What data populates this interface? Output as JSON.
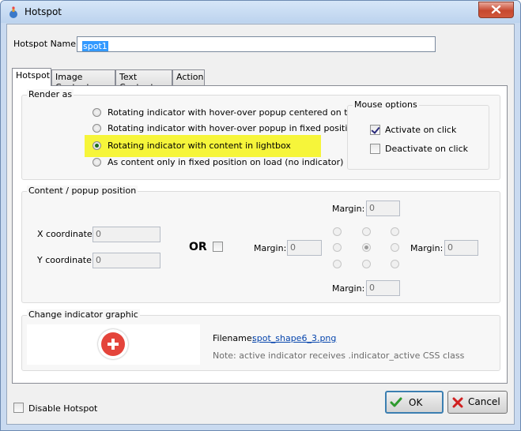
{
  "window": {
    "title": "Hotspot"
  },
  "hotspot_name": {
    "label": "Hotspot Name:",
    "value": "spot1"
  },
  "tabs": [
    {
      "label": "Hotspot"
    },
    {
      "label": "Image Content"
    },
    {
      "label": "Text Content"
    },
    {
      "label": "Action"
    }
  ],
  "render_as": {
    "title": "Render as",
    "options": [
      "Rotating indicator with hover-over popup centered on top",
      "Rotating indicator with hover-over popup in fixed position",
      "Rotating indicator with content in lightbox",
      "As content only in fixed position on load (no indicator)"
    ],
    "selected_index": 2
  },
  "mouse_options": {
    "title": "Mouse  options",
    "activate_label": "Activate on click",
    "activate_checked": true,
    "deactivate_label": "Deactivate on click",
    "deactivate_checked": false
  },
  "position": {
    "title": "Content / popup position",
    "x_label": "X coordinate:",
    "x_value": "0",
    "y_label": "Y coordinate:",
    "y_value": "0",
    "or_label": "OR",
    "margin_label": "Margin:",
    "margin_top": "0",
    "margin_left": "0",
    "margin_right": "0",
    "margin_bottom": "0"
  },
  "indicator": {
    "title": "Change indicator graphic",
    "filename_label": "Filename:",
    "filename": "spot_shape6_3.png",
    "note": "Note: active indicator receives .indicator_active CSS class"
  },
  "footer": {
    "disable_label": "Disable Hotspot",
    "ok_label": "OK",
    "cancel_label": "Cancel"
  },
  "colors": {
    "highlight": "#f6f53a",
    "ok_check": "#2e9a2e",
    "cancel_x": "#d02020",
    "link": "#0645ad"
  }
}
